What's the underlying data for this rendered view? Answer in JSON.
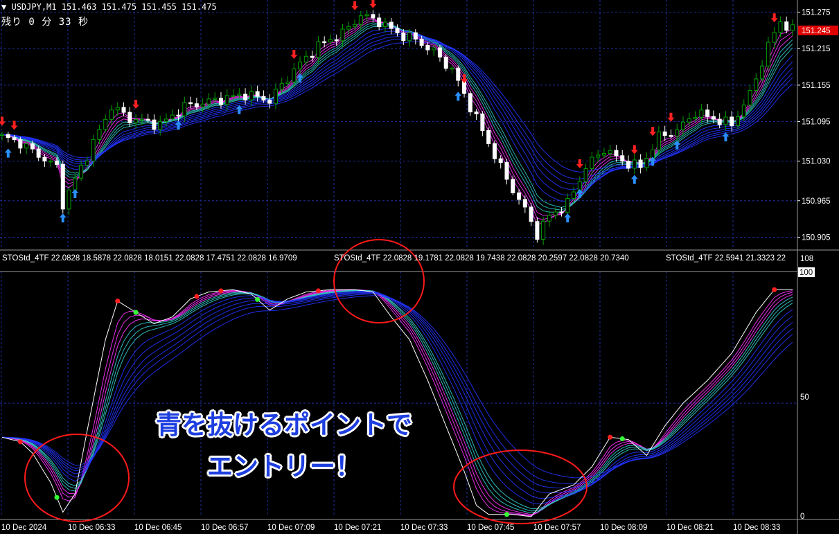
{
  "symbol_header": {
    "arrow": "▼",
    "text": "USDJPY,M1  151.463 151.475 151.455 151.475"
  },
  "countdown": "残り 0 分 33 秒",
  "indicator_labels": [
    "STOStd_4TF 22.0828 18.5878 22.0828 18.0151 22.0828 17.4751 22.0828 16.9709",
    "STOStd_4TF 22.0828 19.1781 22.0828 19.7438 22.0828 20.2597 22.0828 20.7340",
    "STOStd_4TF 22.5941 21.3323 22"
  ],
  "callout": {
    "line1": "青を抜けるポイントで",
    "line2": "エントリー！"
  },
  "colors": {
    "background": "#000000",
    "grid": "#1f2f9f",
    "bull_candle": "#00a000",
    "bear_candle": "#ffffff",
    "ribbon_magenta": "#ff33ff",
    "ribbon_teal": "#33cccc",
    "ribbon_blue": "#2233ff",
    "arrow_up": "#2a8fff",
    "arrow_down": "#ff2020",
    "highlight_circle": "#ff1a1a"
  },
  "chart_data": [
    {
      "type": "line",
      "title": "USDJPY,M1",
      "price_axis_ticks": [
        "151.275",
        "151.215",
        "151.155",
        "151.095",
        "151.030",
        "150.965",
        "150.905"
      ],
      "current_price_tag": "151.245",
      "time_axis_ticks": [
        "10 Dec 2024",
        "10 Dec 06:33",
        "10 Dec 06:45",
        "10 Dec 06:57",
        "10 Dec 07:09",
        "10 Dec 07:21",
        "10 Dec 07:33",
        "10 Dec 07:45",
        "10 Dec 07:57",
        "10 Dec 08:09",
        "10 Dec 08:21",
        "10 Dec 08:33"
      ],
      "ylim": [
        150.885,
        151.295
      ],
      "x_index_range": [
        0,
        130
      ],
      "close": [
        {
          "x": 0,
          "y": 151.07
        },
        {
          "x": 3,
          "y": 151.06
        },
        {
          "x": 6,
          "y": 151.04
        },
        {
          "x": 9,
          "y": 151.02
        },
        {
          "x": 10,
          "y": 150.96
        },
        {
          "x": 12,
          "y": 151.0
        },
        {
          "x": 15,
          "y": 151.06
        },
        {
          "x": 18,
          "y": 151.12
        },
        {
          "x": 21,
          "y": 151.1
        },
        {
          "x": 26,
          "y": 151.09
        },
        {
          "x": 30,
          "y": 151.12
        },
        {
          "x": 35,
          "y": 151.13
        },
        {
          "x": 40,
          "y": 151.14
        },
        {
          "x": 44,
          "y": 151.13
        },
        {
          "x": 48,
          "y": 151.18
        },
        {
          "x": 52,
          "y": 151.22
        },
        {
          "x": 56,
          "y": 151.24
        },
        {
          "x": 59,
          "y": 151.27
        },
        {
          "x": 62,
          "y": 151.26
        },
        {
          "x": 65,
          "y": 151.24
        },
        {
          "x": 68,
          "y": 151.23
        },
        {
          "x": 71,
          "y": 151.21
        },
        {
          "x": 74,
          "y": 151.18
        },
        {
          "x": 77,
          "y": 151.12
        },
        {
          "x": 80,
          "y": 151.06
        },
        {
          "x": 83,
          "y": 151.0
        },
        {
          "x": 86,
          "y": 150.95
        },
        {
          "x": 88,
          "y": 150.91
        },
        {
          "x": 90,
          "y": 150.94
        },
        {
          "x": 93,
          "y": 150.96
        },
        {
          "x": 96,
          "y": 151.02
        },
        {
          "x": 99,
          "y": 151.05
        },
        {
          "x": 102,
          "y": 151.03
        },
        {
          "x": 105,
          "y": 151.02
        },
        {
          "x": 108,
          "y": 151.07
        },
        {
          "x": 111,
          "y": 151.08
        },
        {
          "x": 114,
          "y": 151.11
        },
        {
          "x": 117,
          "y": 151.1
        },
        {
          "x": 120,
          "y": 151.09
        },
        {
          "x": 123,
          "y": 151.14
        },
        {
          "x": 126,
          "y": 151.22
        },
        {
          "x": 128,
          "y": 151.26
        },
        {
          "x": 130,
          "y": 151.245
        }
      ],
      "up_arrows_x": [
        1,
        10,
        12,
        29,
        39,
        49,
        75,
        93,
        95,
        104,
        107,
        111,
        119,
        132
      ],
      "down_arrows_x": [
        0,
        2,
        22,
        48,
        58,
        61,
        76,
        95,
        104,
        107,
        110,
        127,
        140
      ]
    },
    {
      "type": "line",
      "title": "STOStd_4TF",
      "axis_ticks": [
        "108",
        "100",
        "50",
        "0"
      ],
      "ylim": [
        0,
        108
      ],
      "x_index_range": [
        0,
        130
      ],
      "stochastic": [
        {
          "x": 0,
          "y": 35
        },
        {
          "x": 3,
          "y": 33
        },
        {
          "x": 5,
          "y": 28
        },
        {
          "x": 8,
          "y": 15
        },
        {
          "x": 10,
          "y": 2
        },
        {
          "x": 12,
          "y": 10
        },
        {
          "x": 14,
          "y": 38
        },
        {
          "x": 17,
          "y": 78
        },
        {
          "x": 19,
          "y": 95
        },
        {
          "x": 22,
          "y": 90
        },
        {
          "x": 25,
          "y": 85
        },
        {
          "x": 28,
          "y": 88
        },
        {
          "x": 31,
          "y": 96
        },
        {
          "x": 34,
          "y": 99
        },
        {
          "x": 38,
          "y": 100
        },
        {
          "x": 41,
          "y": 98
        },
        {
          "x": 44,
          "y": 91
        },
        {
          "x": 47,
          "y": 96
        },
        {
          "x": 50,
          "y": 99
        },
        {
          "x": 54,
          "y": 100
        },
        {
          "x": 58,
          "y": 100
        },
        {
          "x": 61,
          "y": 99
        },
        {
          "x": 64,
          "y": 88
        },
        {
          "x": 67,
          "y": 78
        },
        {
          "x": 70,
          "y": 60
        },
        {
          "x": 73,
          "y": 40
        },
        {
          "x": 76,
          "y": 20
        },
        {
          "x": 78,
          "y": 5
        },
        {
          "x": 80,
          "y": 1
        },
        {
          "x": 84,
          "y": 1
        },
        {
          "x": 87,
          "y": 0
        },
        {
          "x": 90,
          "y": 10
        },
        {
          "x": 94,
          "y": 14
        },
        {
          "x": 97,
          "y": 22
        },
        {
          "x": 100,
          "y": 35
        },
        {
          "x": 103,
          "y": 34
        },
        {
          "x": 106,
          "y": 27
        },
        {
          "x": 109,
          "y": 40
        },
        {
          "x": 112,
          "y": 50
        },
        {
          "x": 116,
          "y": 60
        },
        {
          "x": 120,
          "y": 72
        },
        {
          "x": 124,
          "y": 90
        },
        {
          "x": 127,
          "y": 100
        },
        {
          "x": 130,
          "y": 100
        }
      ]
    }
  ]
}
